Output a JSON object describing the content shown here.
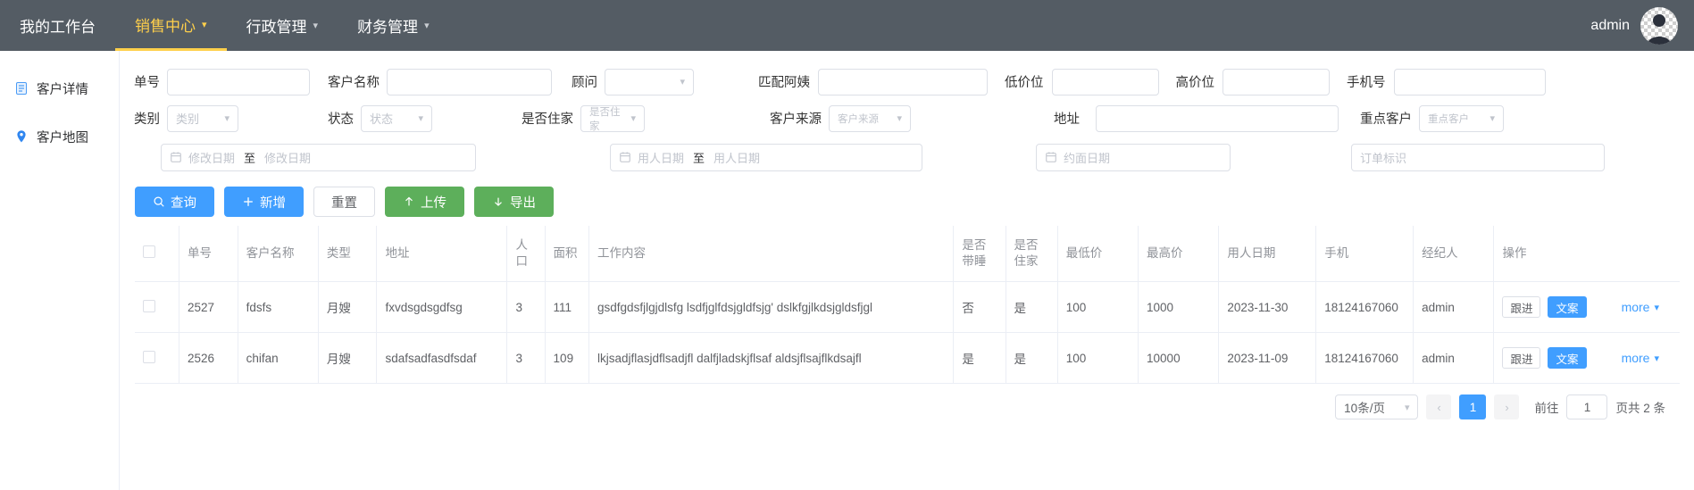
{
  "header": {
    "nav": [
      {
        "label": "我的工作台",
        "has_chevron": false,
        "active": false
      },
      {
        "label": "销售中心",
        "has_chevron": true,
        "active": true
      },
      {
        "label": "行政管理",
        "has_chevron": true,
        "active": false
      },
      {
        "label": "财务管理",
        "has_chevron": true,
        "active": false
      }
    ],
    "user": "admin",
    "accent_color": "#ffd04b",
    "bar_color": "#545c64"
  },
  "sidebar": {
    "items": [
      {
        "label": "客户详情",
        "icon": "document-icon"
      },
      {
        "label": "客户地图",
        "icon": "location-pin-icon"
      }
    ]
  },
  "filters": {
    "order_no": {
      "label": "单号",
      "value": "",
      "placeholder": ""
    },
    "customer_name": {
      "label": "客户名称",
      "value": "",
      "placeholder": ""
    },
    "consultant": {
      "label": "顾问",
      "value": "",
      "placeholder": ""
    },
    "match_aunt": {
      "label": "匹配阿姨",
      "value": "",
      "placeholder": ""
    },
    "low_price": {
      "label": "低价位",
      "value": "",
      "placeholder": ""
    },
    "high_price": {
      "label": "高价位",
      "value": "",
      "placeholder": ""
    },
    "phone": {
      "label": "手机号",
      "value": "",
      "placeholder": ""
    },
    "category": {
      "label": "类别",
      "placeholder": "类别"
    },
    "status": {
      "label": "状态",
      "placeholder": "状态"
    },
    "live_in": {
      "label": "是否住家",
      "placeholder": "是否住家"
    },
    "customer_source": {
      "label": "客户来源",
      "placeholder": "客户来源"
    },
    "address": {
      "label": "地址",
      "value": "",
      "placeholder": ""
    },
    "key_customer": {
      "label": "重点客户",
      "placeholder": "重点客户"
    },
    "modify_date": {
      "start_placeholder": "修改日期",
      "separator": "至",
      "end_placeholder": "修改日期"
    },
    "employ_date": {
      "start_placeholder": "用人日期",
      "separator": "至",
      "end_placeholder": "用人日期"
    },
    "meet_date": {
      "placeholder": "约面日期"
    },
    "order_mark": {
      "placeholder": "订单标识"
    }
  },
  "buttons": [
    {
      "label": "查询",
      "icon": "search-icon",
      "style": "primary"
    },
    {
      "label": "新增",
      "icon": "plus-icon",
      "style": "primary"
    },
    {
      "label": "重置",
      "icon": "",
      "style": "default"
    },
    {
      "label": "上传",
      "icon": "upload-icon",
      "style": "success"
    },
    {
      "label": "导出",
      "icon": "download-icon",
      "style": "success"
    }
  ],
  "table": {
    "columns": [
      "",
      "单号",
      "客户名称",
      "类型",
      "地址",
      "人口",
      "面积",
      "工作内容",
      "是否带睡",
      "是否住家",
      "最低价",
      "最高价",
      "用人日期",
      "手机",
      "经纪人",
      "操作"
    ],
    "rows": [
      {
        "order_no": "2527",
        "customer_name": "fdsfs",
        "type": "月嫂",
        "address": "fxvdsgdsgdfsg",
        "population": "3",
        "area": "111",
        "work_content": "gsdfgdsfjlgjdlsfg lsdfjglfdsjgldfsjg' dslkfgjlkdsjgldsfjgl",
        "sleep_in": "否",
        "live_in": "是",
        "min_price": "100",
        "max_price": "1000",
        "employ_date": "2023-11-30",
        "phone": "18124167060",
        "agent": "admin",
        "actions": {
          "follow": "跟进",
          "copy": "文案",
          "more": "more"
        }
      },
      {
        "order_no": "2526",
        "customer_name": "chifan",
        "type": "月嫂",
        "address": "sdafsadfasdfsdaf",
        "population": "3",
        "area": "109",
        "work_content": "lkjsadjflasjdflsadjfl dalfjladskjflsaf aldsjflsajflkdsajfl",
        "sleep_in": "是",
        "live_in": "是",
        "min_price": "100",
        "max_price": "10000",
        "employ_date": "2023-11-09",
        "phone": "18124167060",
        "agent": "admin",
        "actions": {
          "follow": "跟进",
          "copy": "文案",
          "more": "more"
        }
      }
    ]
  },
  "pagination": {
    "page_size": "10条/页",
    "prev": "‹",
    "next": "›",
    "current_page": "1",
    "jump_label": "前往",
    "jump_value": "1",
    "total_text": "页共 2 条"
  }
}
